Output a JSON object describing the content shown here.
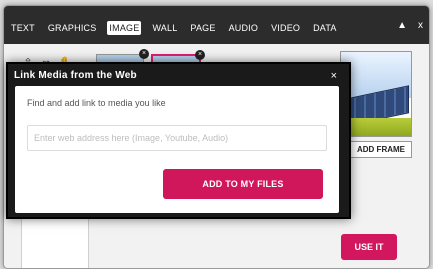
{
  "toolbar": {
    "tabs": [
      "TEXT",
      "GRAPHICS",
      "IMAGE",
      "WALL",
      "PAGE",
      "AUDIO",
      "VIDEO",
      "DATA"
    ],
    "active_tab": "IMAGE",
    "minimize_symbol": "▲",
    "close_symbol": "x"
  },
  "tools": [
    {
      "icon": "upload-icon"
    },
    {
      "icon": "link-icon"
    },
    {
      "icon": "hand-icon"
    }
  ],
  "thumbnails": [
    {
      "close_symbol": "×"
    },
    {
      "close_symbol": "×"
    }
  ],
  "frame": {
    "add_label": "ADD FRAME"
  },
  "actions": {
    "use_it": "USE IT"
  },
  "modal": {
    "title": "Link Media from the Web",
    "close_symbol": "×",
    "instruction": "Find and add link to media you like",
    "url_placeholder": "Enter web address here (Image, Youtube, Audio)",
    "url_value": "",
    "add_button": "ADD TO MY FILES"
  },
  "colors": {
    "accent": "#d0175c",
    "dark": "#1a1a1a"
  }
}
